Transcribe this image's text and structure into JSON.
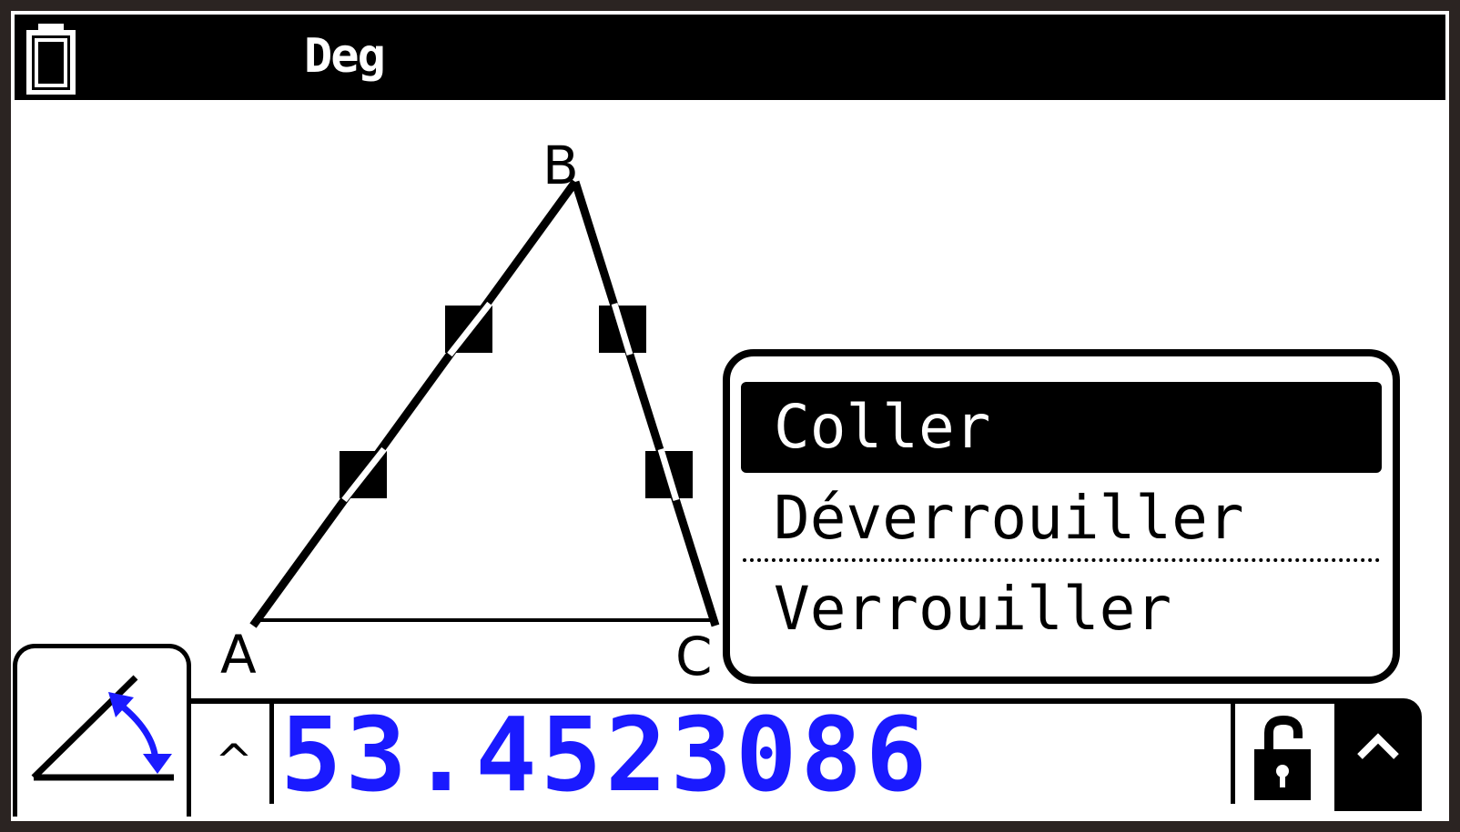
{
  "status_bar": {
    "battery_icon": "battery-icon",
    "angle_mode": "Deg"
  },
  "geometry": {
    "vertices": {
      "a": "A",
      "b": "B",
      "c": "C"
    }
  },
  "context_menu": {
    "items": [
      {
        "label": "Coller",
        "selected": true
      },
      {
        "label": "Déverrouiller",
        "selected": false
      },
      {
        "label": "Verrouiller",
        "selected": false
      }
    ]
  },
  "bottom_bar": {
    "tool_icon": "angle-measure-icon",
    "caret_left": "^",
    "value": "53.4523086",
    "value_color": "#1a1aff",
    "lock_icon": "unlocked-padlock-icon",
    "up_icon": "caret-up-icon"
  }
}
